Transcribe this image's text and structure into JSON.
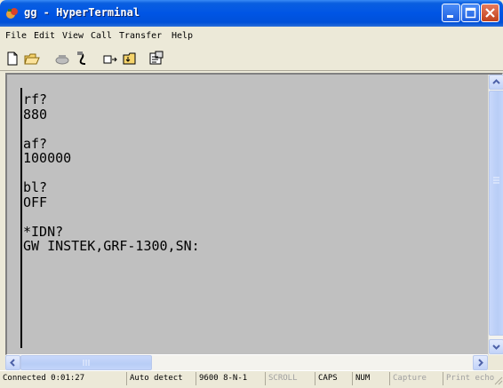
{
  "window": {
    "title": "gg - HyperTerminal"
  },
  "menu": [
    "File",
    "Edit",
    "View",
    "Call",
    "Transfer",
    "Help"
  ],
  "toolbar": {
    "buttons": [
      "new-icon",
      "open-icon",
      "connect-icon",
      "disconnect-icon",
      "send-icon",
      "receive-icon",
      "properties-icon"
    ]
  },
  "terminal": {
    "text": "rf?\n880\n\naf?\n100000\n\nbl?\nOFF\n\n*IDN?\nGW INSTEK,GRF-1300,SN:"
  },
  "status": {
    "connected": "Connected 0:01:27",
    "detect": "Auto detect",
    "port": "9600 8-N-1",
    "scroll": "SCROLL",
    "caps": "CAPS",
    "num": "NUM",
    "capture": "Capture",
    "print_echo": "Print echo"
  },
  "colors": {
    "titlebar": "#0055e5",
    "terminal_bg": "#c0c0c0",
    "close_button": "#c0411c"
  }
}
